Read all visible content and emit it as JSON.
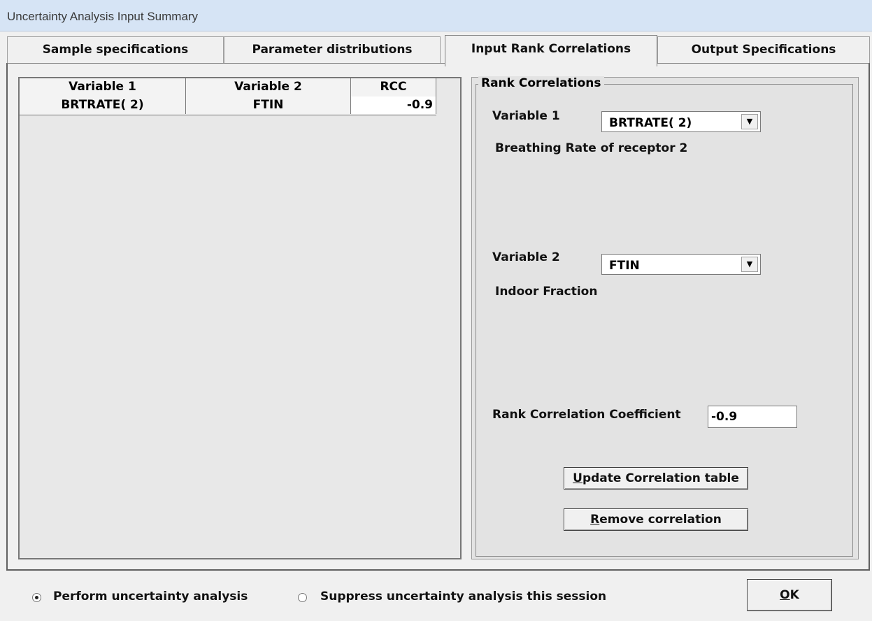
{
  "window": {
    "title": "Uncertainty Analysis Input Summary"
  },
  "tabs": [
    {
      "label": "Sample specifications",
      "active": false
    },
    {
      "label": "Parameter distributions",
      "active": false
    },
    {
      "label": "Input Rank Correlations",
      "active": true
    },
    {
      "label": "Output Specifications",
      "active": false
    }
  ],
  "grid": {
    "columns": [
      "Variable 1",
      "Variable 2",
      "RCC"
    ],
    "rows": [
      {
        "var1": "BRTRATE( 2)",
        "var2": "FTIN",
        "rcc": "-0.9"
      }
    ]
  },
  "rank_correlations": {
    "legend": "Rank Correlations",
    "variable1_label": "Variable 1",
    "variable1_value": "BRTRATE( 2)",
    "variable1_desc": "Breathing Rate of receptor  2",
    "variable2_label": "Variable 2",
    "variable2_value": "FTIN",
    "variable2_desc": "Indoor Fraction",
    "coef_label": "Rank Correlation Coefficient",
    "coef_value": "-0.9",
    "update_button": {
      "mnemonic": "U",
      "rest": "pdate Correlation table"
    },
    "remove_button": {
      "mnemonic": "R",
      "rest": "emove correlation"
    }
  },
  "footer": {
    "perform_label": "Perform uncertainty analysis",
    "suppress_label": "Suppress uncertainty analysis this session",
    "selected": "perform",
    "ok_button": {
      "mnemonic": "O",
      "rest": "K"
    }
  }
}
